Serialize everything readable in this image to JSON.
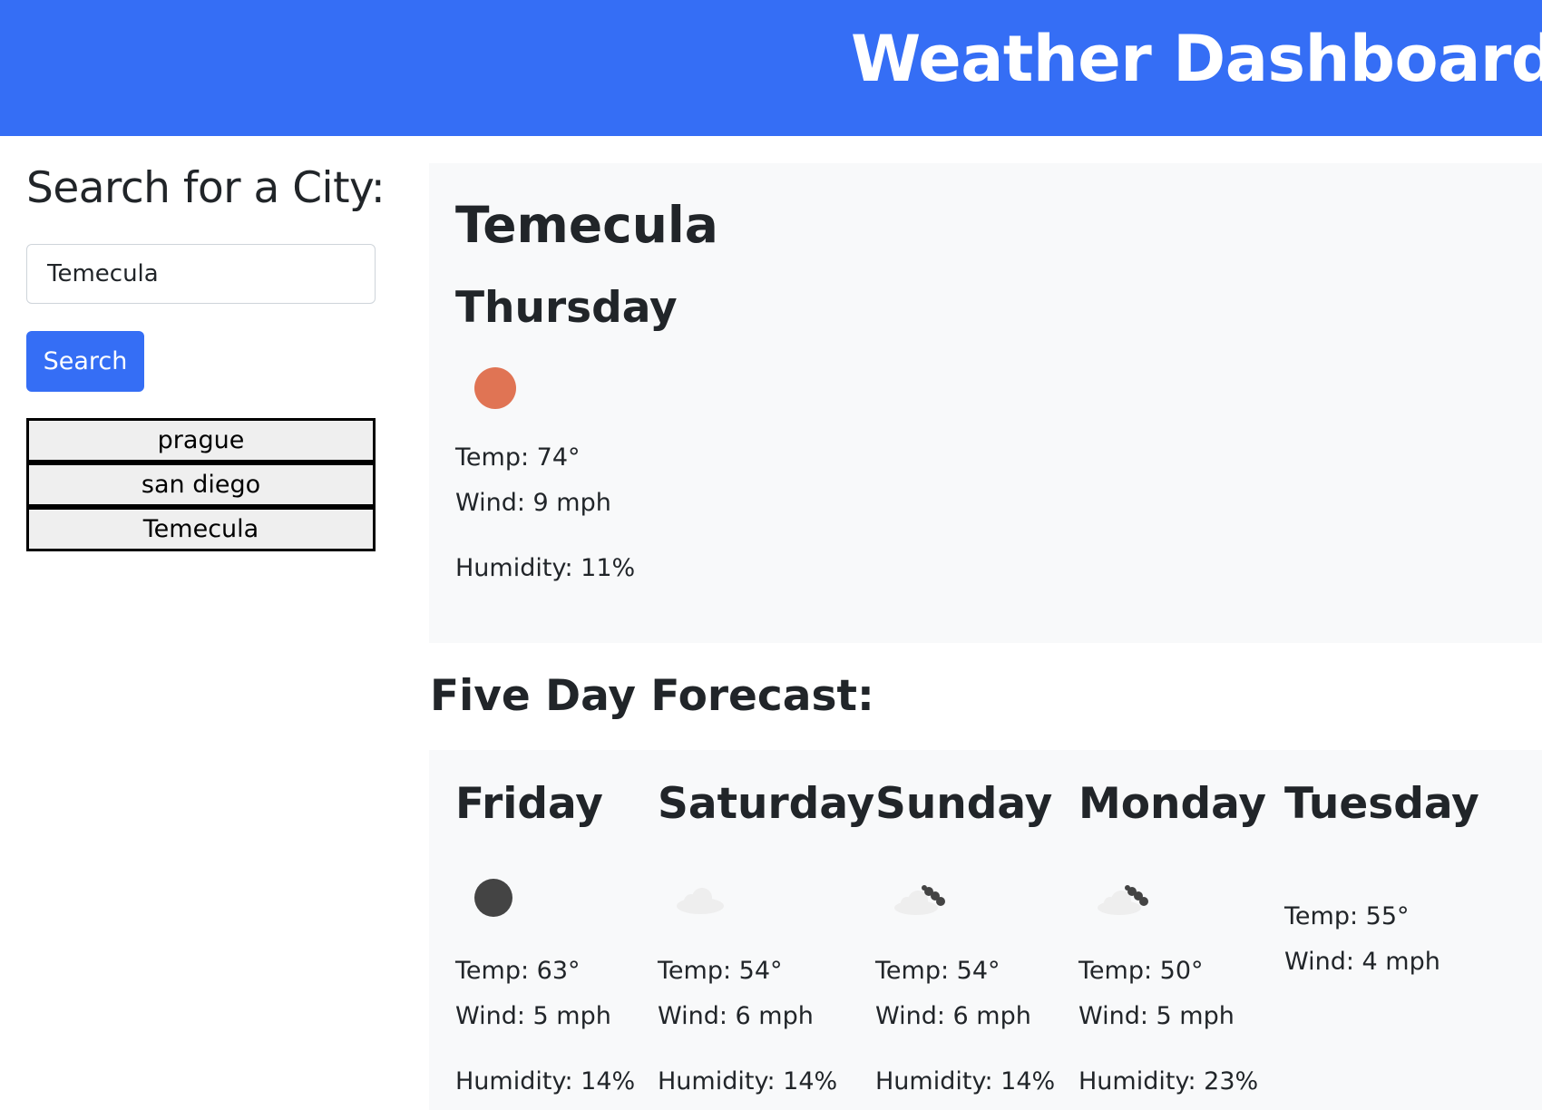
{
  "header": {
    "title": "Weather Dashboard"
  },
  "search": {
    "heading": "Search for a City:",
    "input_value": "Temecula",
    "button_label": "Search",
    "history": [
      "prague",
      "san diego",
      "Temecula"
    ]
  },
  "current": {
    "city": "Temecula",
    "day": "Thursday",
    "icon": "sun-icon",
    "icon_color": "#e07454",
    "temp": "Temp: 74°",
    "wind": "Wind: 9 mph",
    "humidity": "Humidity: 11%"
  },
  "forecast": {
    "heading": "Five Day Forecast:",
    "days": [
      {
        "name": "Friday",
        "icon": "moon-icon",
        "temp": "Temp: 63°",
        "wind": "Wind: 5 mph",
        "humidity": "Humidity: 14%"
      },
      {
        "name": "Saturday",
        "icon": "cloud-icon",
        "temp": "Temp: 54°",
        "wind": "Wind: 6 mph",
        "humidity": "Humidity: 14%"
      },
      {
        "name": "Sunday",
        "icon": "partly-cloudy-icon",
        "temp": "Temp: 54°",
        "wind": "Wind: 6 mph",
        "humidity": "Humidity: 14%"
      },
      {
        "name": "Monday",
        "icon": "partly-cloudy-icon",
        "temp": "Temp: 50°",
        "wind": "Wind: 5 mph",
        "humidity": "Humidity: 23%"
      },
      {
        "name": "Tuesday",
        "icon": "",
        "temp": "Temp: 55°",
        "wind": "Wind: 4 mph",
        "humidity": ""
      }
    ]
  },
  "colors": {
    "brand": "#356ef5",
    "panel": "#f8f9fa"
  }
}
